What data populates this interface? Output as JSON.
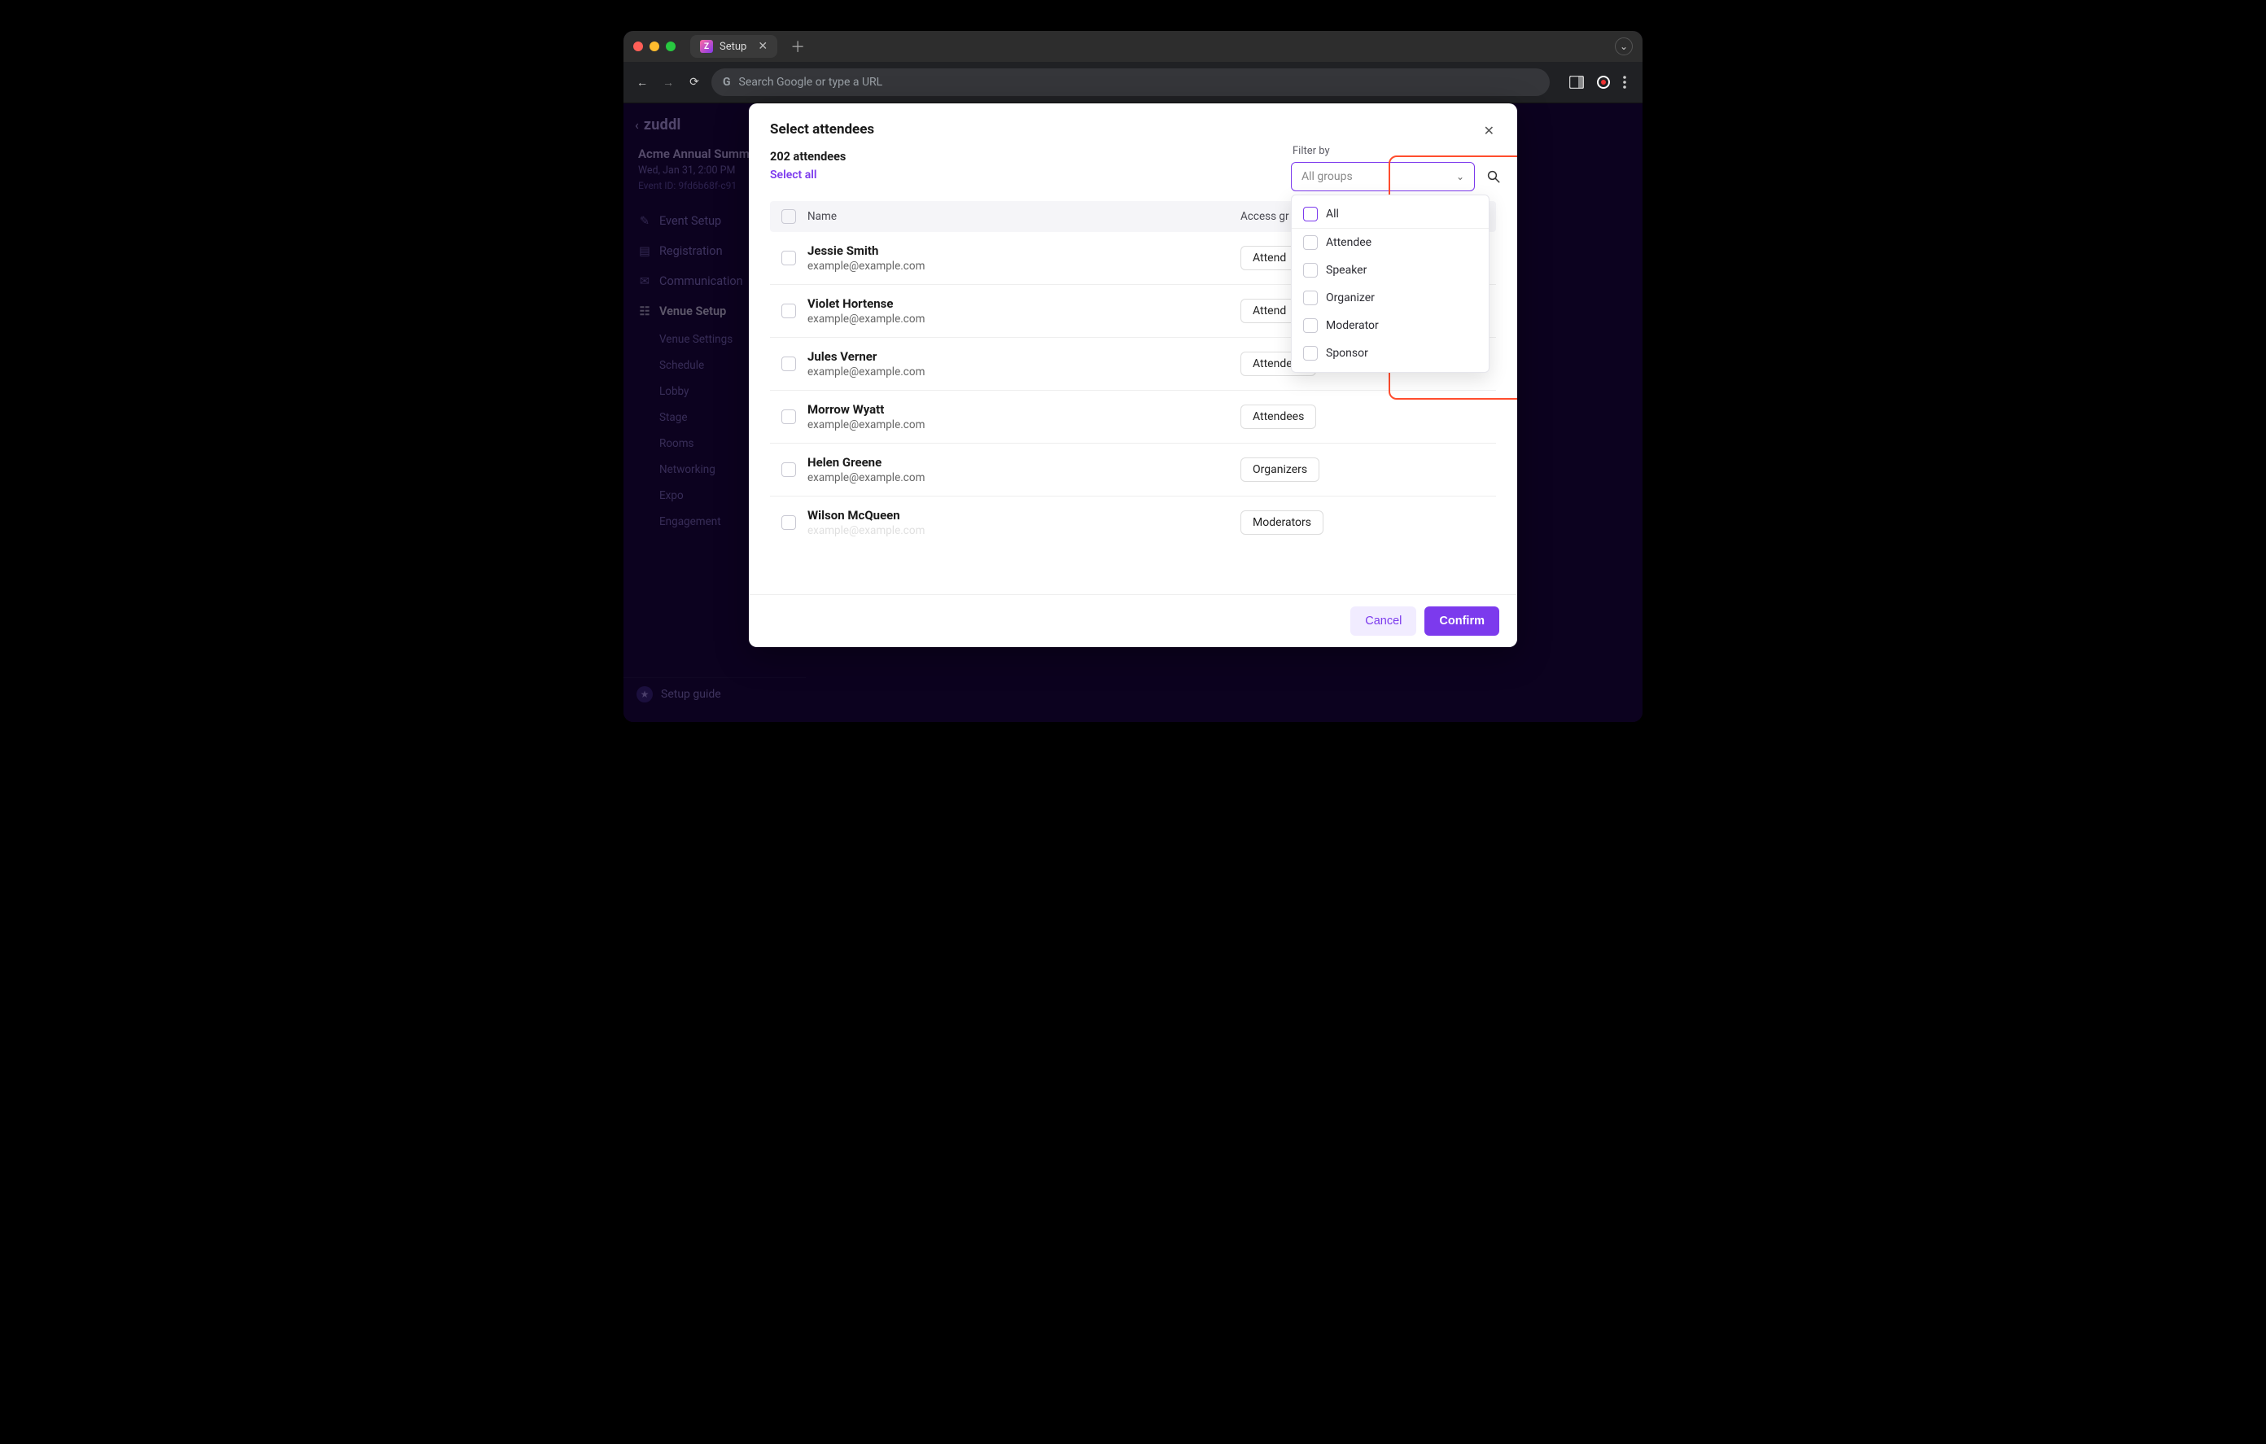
{
  "browser": {
    "tab_title": "Setup",
    "address_placeholder": "Search Google or type a URL"
  },
  "brand": {
    "label": "zuddl"
  },
  "event": {
    "title": "Acme Annual Summ",
    "datetime": "Wed, Jan 31, 2:00 PM",
    "id_label": "Event ID: 9fd6b68f-c91"
  },
  "nav": {
    "items": [
      {
        "label": "Event Setup"
      },
      {
        "label": "Registration"
      },
      {
        "label": "Communication"
      },
      {
        "label": "Venue Setup",
        "active": true
      }
    ],
    "sub": [
      {
        "label": "Venue Settings"
      },
      {
        "label": "Schedule"
      },
      {
        "label": "Lobby"
      },
      {
        "label": "Stage"
      },
      {
        "label": "Rooms"
      },
      {
        "label": "Networking"
      },
      {
        "label": "Expo"
      },
      {
        "label": "Engagement"
      }
    ],
    "setup_guide": "Setup guide"
  },
  "modal": {
    "title": "Select attendees",
    "count": "202 attendees",
    "select_all": "Select all",
    "filter_label": "Filter by",
    "filter_value": "All groups",
    "table": {
      "name_header": "Name",
      "group_header": "Access gr"
    },
    "filter_options": [
      "All",
      "Attendee",
      "Speaker",
      "Organizer",
      "Moderator",
      "Sponsor"
    ],
    "rows": [
      {
        "name": "Jessie Smith",
        "email": "example@example.com",
        "group": "Attend"
      },
      {
        "name": "Violet Hortense",
        "email": "example@example.com",
        "group": "Attend"
      },
      {
        "name": "Jules Verner",
        "email": "example@example.com",
        "group": "Attendees"
      },
      {
        "name": "Morrow Wyatt",
        "email": "example@example.com",
        "group": "Attendees"
      },
      {
        "name": "Helen Greene",
        "email": "example@example.com",
        "group": "Organizers"
      },
      {
        "name": "Wilson McQueen",
        "email": "example@example.com",
        "group": "Moderators"
      }
    ],
    "cancel": "Cancel",
    "confirm": "Confirm"
  }
}
